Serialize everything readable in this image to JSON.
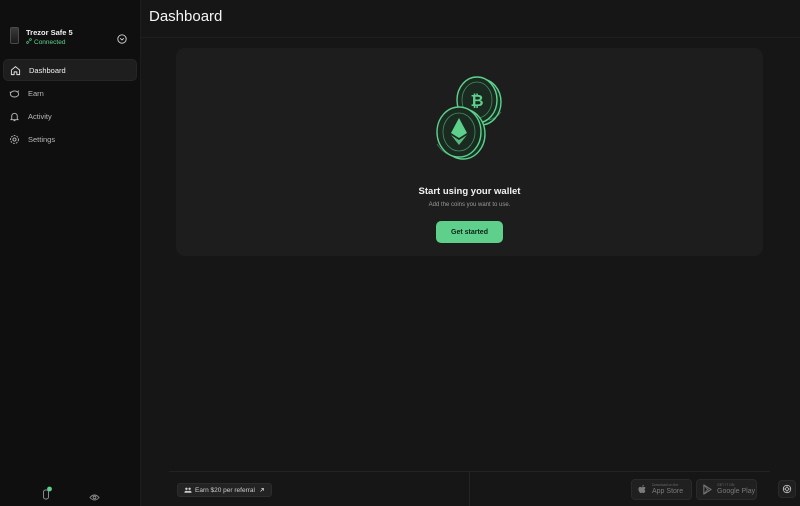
{
  "device": {
    "name": "Trezor Safe 5",
    "status": "Connected"
  },
  "sidebar": {
    "items": [
      {
        "label": "Dashboard",
        "icon": "home-icon",
        "active": true
      },
      {
        "label": "Earn",
        "icon": "piggy-bank-icon",
        "active": false
      },
      {
        "label": "Activity",
        "icon": "bell-icon",
        "active": false
      },
      {
        "label": "Settings",
        "icon": "gear-icon",
        "active": false
      }
    ]
  },
  "header": {
    "title": "Dashboard"
  },
  "empty_state": {
    "title": "Start using your wallet",
    "subtitle": "Add the coins you want to use.",
    "cta_label": "Get started"
  },
  "footer": {
    "referral_label": "Earn $20 per referral",
    "app_store": {
      "small": "Download on the",
      "big": "App Store"
    },
    "google_play": {
      "small": "GET IT ON",
      "big": "Google Play"
    }
  },
  "colors": {
    "accent": "#5ed08b",
    "background": "#161616",
    "sidebar": "#0f0f0f",
    "card": "#1d1d1d"
  }
}
